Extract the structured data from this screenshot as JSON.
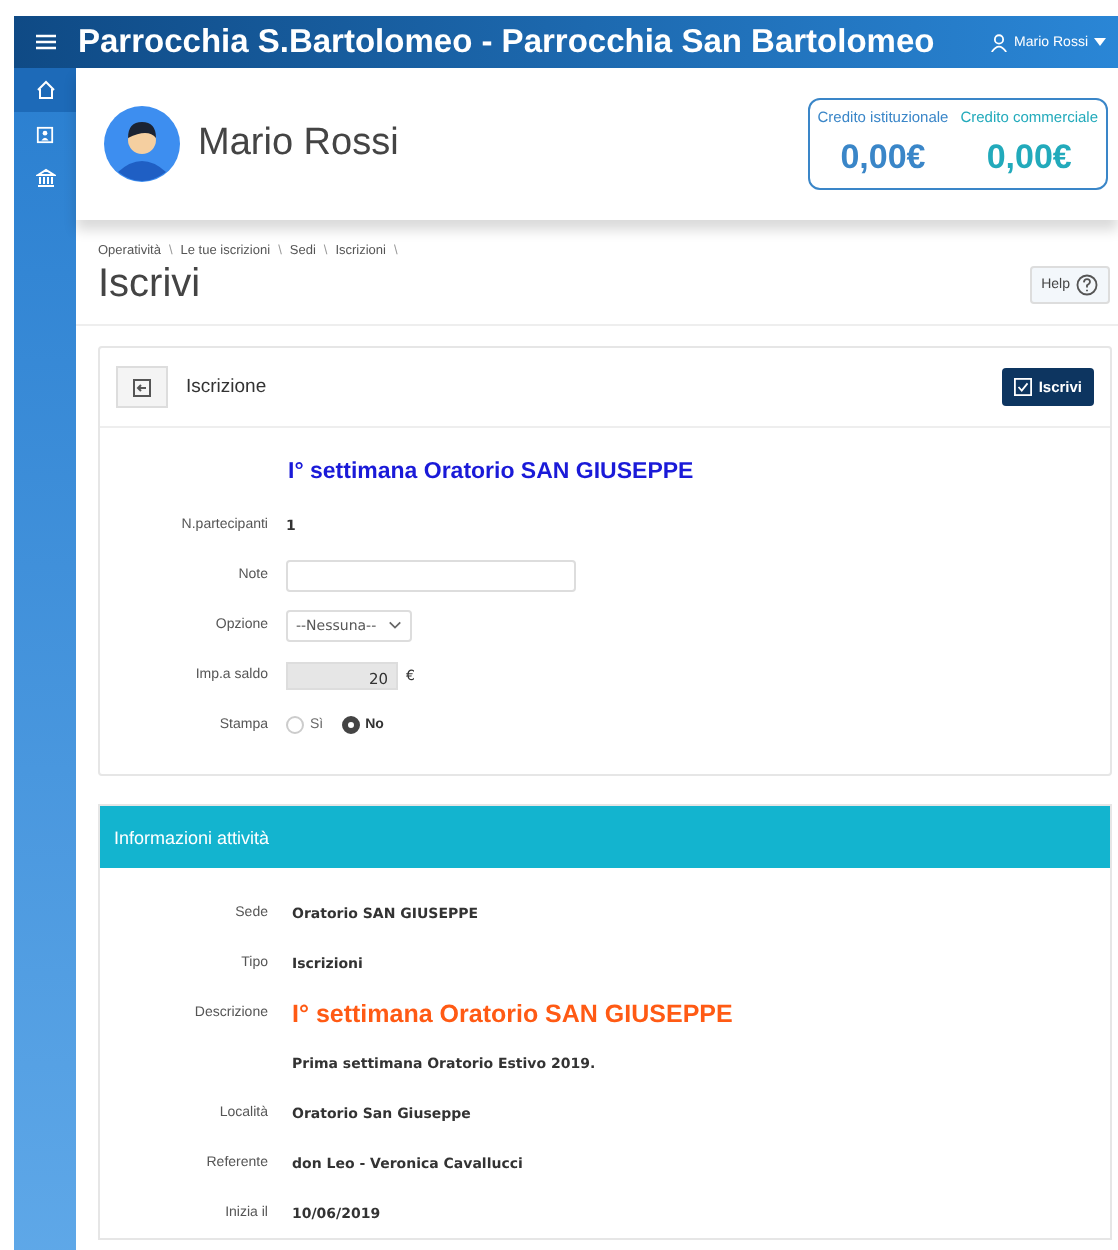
{
  "header": {
    "title": "Parrocchia S.Bartolomeo - Parrocchia San Bartolomeo",
    "user": "Mario Rossi"
  },
  "sidebar": {
    "items": [
      {
        "selected": true
      },
      {
        "selected": false
      },
      {
        "selected": false
      }
    ]
  },
  "profile": {
    "name": "Mario Rossi",
    "credits": [
      {
        "label": "Credito istituzionale",
        "value": "0,00€",
        "color": "#3a86c8"
      },
      {
        "label": "Credito commerciale",
        "value": "0,00€",
        "color": "#22aabb"
      }
    ]
  },
  "breadcrumb": [
    "Operatività",
    "Le tue iscrizioni",
    "Sedi",
    "Iscrizioni"
  ],
  "breadcrumb_separator": "\\",
  "page_title": "Iscrivi",
  "help_button": "Help",
  "form": {
    "title": "Iscrizione",
    "submit": "Iscrivi",
    "activity": "I° settimana Oratorio SAN GIUSEPPE",
    "fields": [
      {
        "kind": "text",
        "label": "N.partecipanti",
        "value": "1"
      },
      {
        "kind": "input",
        "label": "Note"
      },
      {
        "kind": "select",
        "label": "Opzione",
        "value": "--Nessuna--"
      },
      {
        "kind": "amount",
        "label": "Imp.a saldo",
        "value": "20",
        "unit": "€"
      },
      {
        "kind": "radio",
        "label": "Stampa",
        "options": [
          {
            "label": "Sì",
            "selected": false
          },
          {
            "label": "No",
            "selected": true
          }
        ]
      }
    ]
  },
  "info": {
    "title": "Informazioni attività",
    "rows": [
      {
        "kind": "text",
        "label": "Sede",
        "value": "Oratorio SAN GIUSEPPE"
      },
      {
        "kind": "text",
        "label": "Tipo",
        "value": "Iscrizioni"
      },
      {
        "kind": "highlight",
        "label": "Descrizione",
        "value": "I° settimana Oratorio SAN GIUSEPPE"
      },
      {
        "kind": "text",
        "label": "",
        "value": "Prima settimana Oratorio Estivo 2019."
      },
      {
        "kind": "text",
        "label": "Località",
        "value": "Oratorio San Giuseppe"
      },
      {
        "kind": "text",
        "label": "Referente",
        "value": "don Leo - Veronica Cavallucci"
      },
      {
        "kind": "text",
        "label": "Inizia il",
        "value": "10/06/2019"
      }
    ]
  }
}
